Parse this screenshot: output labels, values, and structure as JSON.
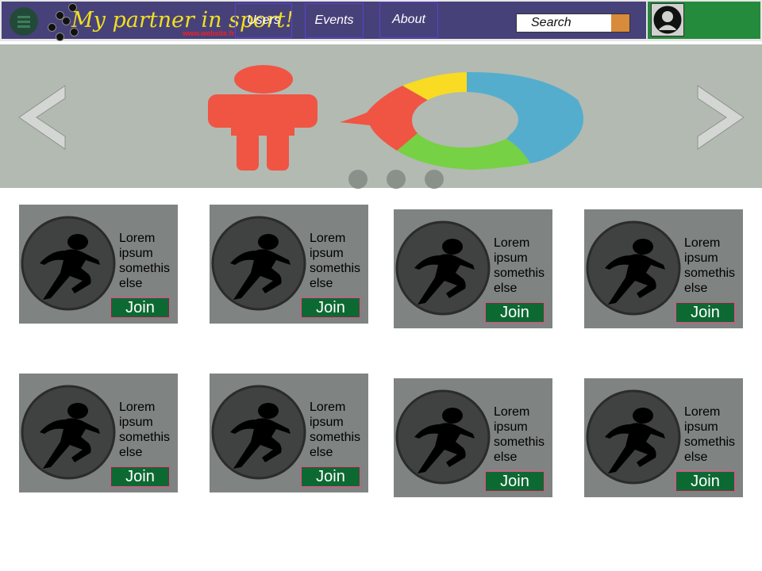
{
  "header": {
    "logo_title": "My partner in sport!",
    "logo_subtitle": "www.website.fr",
    "nav": [
      {
        "label": "Users"
      },
      {
        "label": "Events"
      },
      {
        "label": "About"
      }
    ],
    "search_placeholder": "Search"
  },
  "banner": {
    "prev_icon": "chevron-left-icon",
    "next_icon": "chevron-right-icon",
    "slide_count": 3
  },
  "events": [
    {
      "text": "Lorem ipsum somethis else",
      "button": "Join"
    },
    {
      "text": "Lorem ipsum somethis else",
      "button": "Join"
    },
    {
      "text": "Lorem ipsum somethis else",
      "button": "Join"
    },
    {
      "text": "Lorem ipsum somethis else",
      "button": "Join"
    },
    {
      "text": "Lorem ipsum somethis else",
      "button": "Join"
    },
    {
      "text": "Lorem ipsum somethis else",
      "button": "Join"
    },
    {
      "text": "Lorem ipsum somethis else",
      "button": "Join"
    },
    {
      "text": "Lorem ipsum somethis else",
      "button": "Join"
    }
  ],
  "colors": {
    "nav_bg": "#47417a",
    "profile_bg": "#248a3c",
    "banner_bg": "#b2bab2",
    "card_bg": "#7f8381",
    "join_bg": "#0d6932",
    "join_border": "#ff3e8c"
  }
}
